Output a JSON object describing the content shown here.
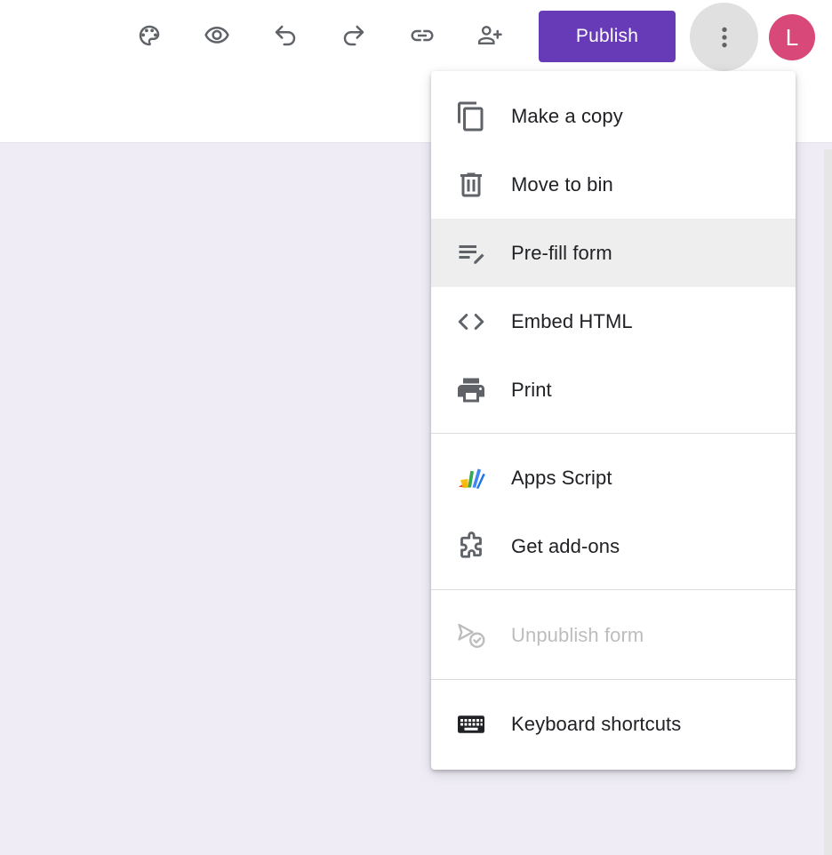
{
  "toolbar": {
    "icons": [
      "palette-icon",
      "eye-icon",
      "undo-icon",
      "redo-icon",
      "link-icon",
      "add-collaborator-icon"
    ],
    "publish_label": "Publish",
    "more_icon": "more-vert-icon",
    "avatar_initial": "L",
    "avatar_color": "#d8497a",
    "accent_color": "#673ab7"
  },
  "menu": {
    "items": [
      {
        "label": "Make a copy",
        "icon": "copy-icon"
      },
      {
        "label": "Move to bin",
        "icon": "trash-icon"
      },
      {
        "label": "Pre-fill form",
        "icon": "prefill-icon",
        "highlighted": true
      },
      {
        "label": "Embed HTML",
        "icon": "code-icon"
      },
      {
        "label": "Print",
        "icon": "print-icon"
      },
      {
        "label": "Apps Script",
        "icon": "apps-script-icon"
      },
      {
        "label": "Get add-ons",
        "icon": "puzzle-icon"
      },
      {
        "label": "Unpublish form",
        "icon": "unpublish-icon",
        "disabled": true
      },
      {
        "label": "Keyboard shortcuts",
        "icon": "keyboard-icon"
      }
    ]
  },
  "canvas_color": "#efecf6"
}
